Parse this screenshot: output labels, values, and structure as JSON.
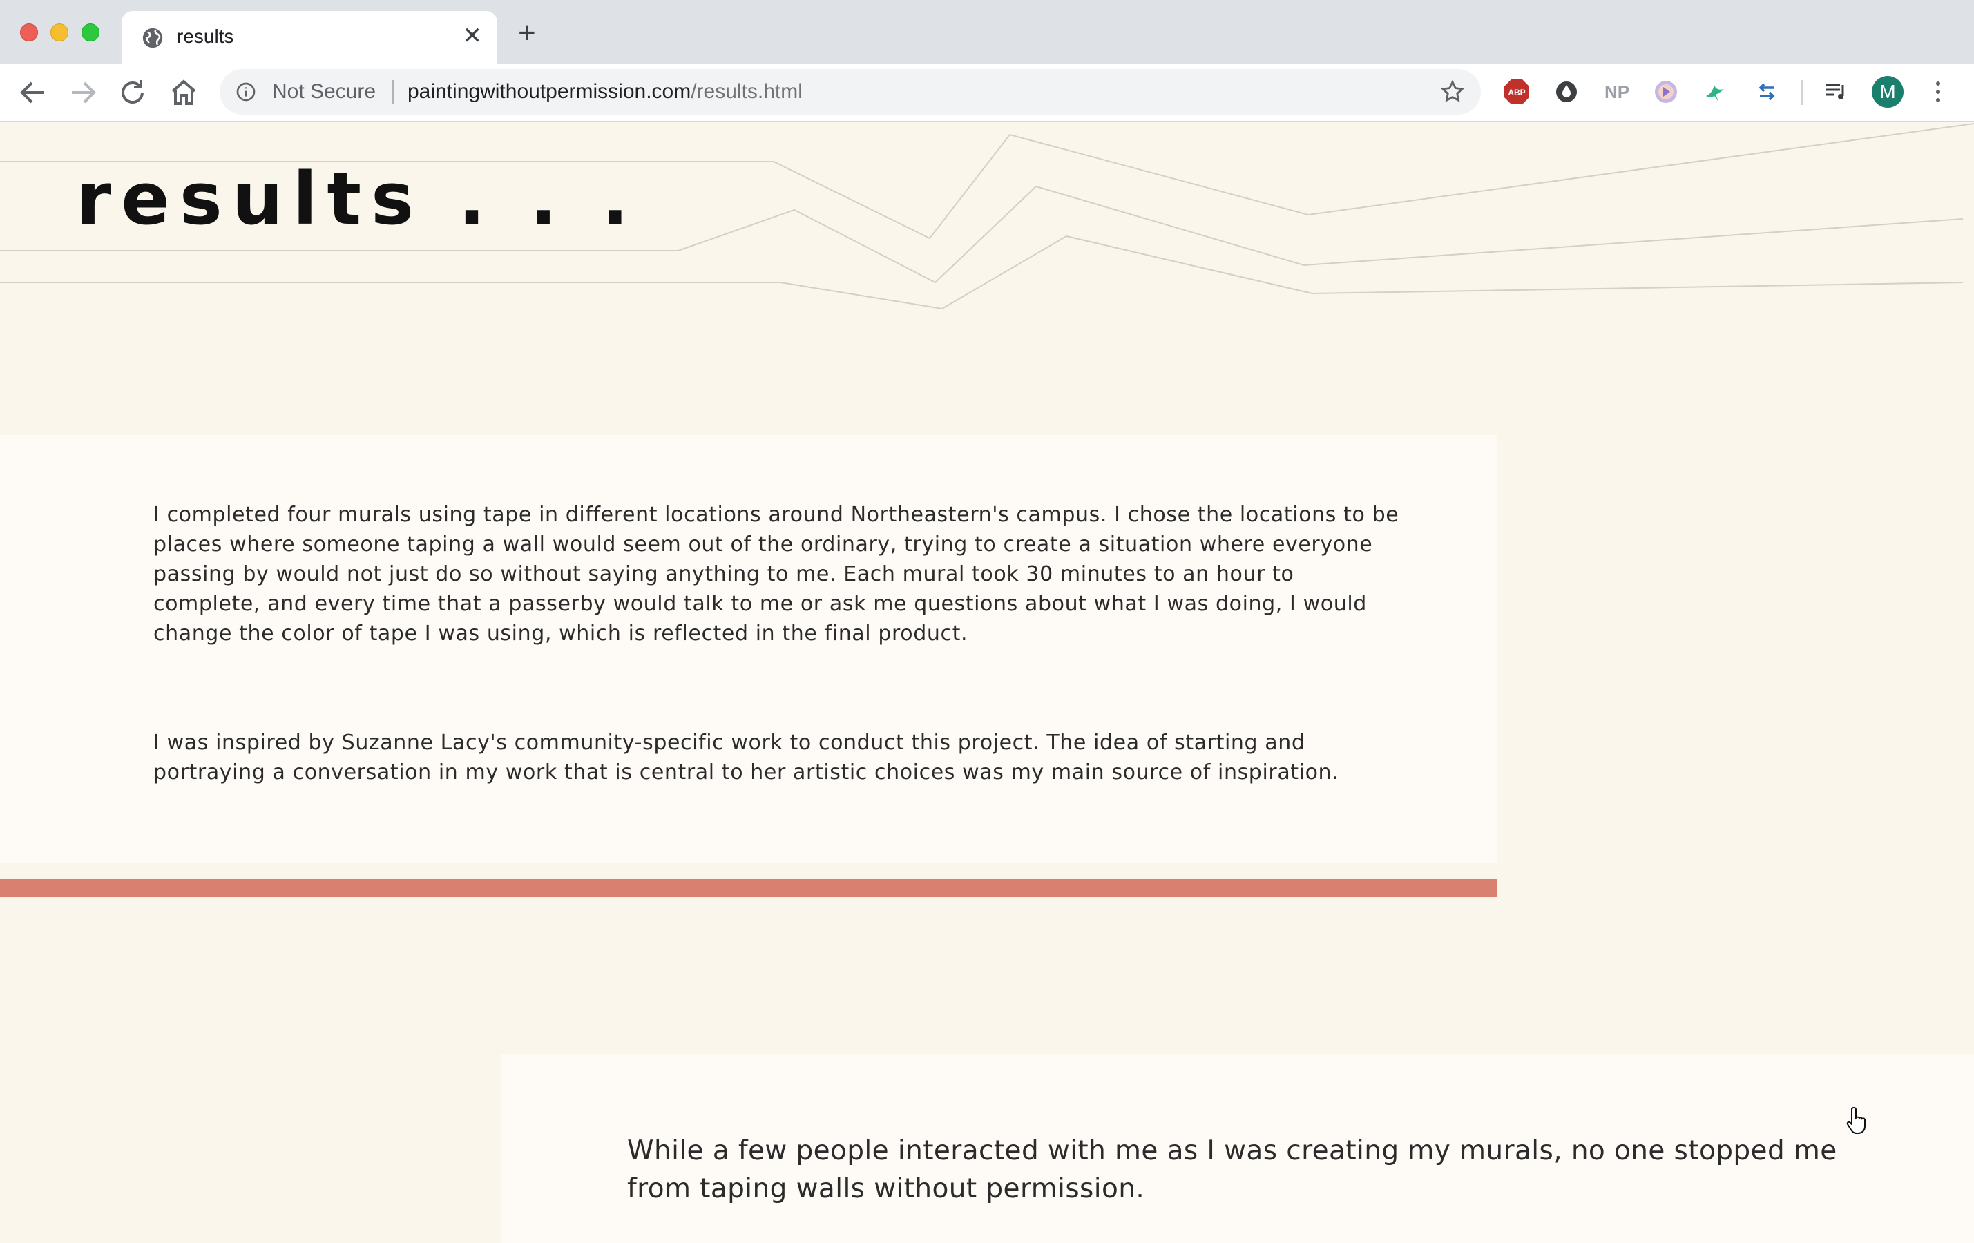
{
  "browser": {
    "tab_title": "results",
    "new_tab_symbol": "+",
    "close_symbol": "✕",
    "security_label": "Not Secure",
    "url_host": "paintingwithoutpermission.com",
    "url_path": "/results.html",
    "profile_initial": "M",
    "extension_labels": {
      "abp": "ABP",
      "np": "NP"
    },
    "icons": [
      "globe-icon",
      "back-icon",
      "forward-icon",
      "reload-icon",
      "home-icon",
      "info-icon",
      "star-icon",
      "adblock-icon",
      "drop-icon",
      "np-icon",
      "play-icon",
      "bird-icon",
      "arrows-icon",
      "media-icon",
      "menu-icon"
    ]
  },
  "page": {
    "title": "results . . .",
    "paragraph_1": "I completed four murals using tape in different locations around Northeastern's campus. I chose the locations to be places where someone taping a wall would seem out of the ordinary, trying to create a situation where everyone passing by would not just do so without saying anything to me. Each mural took 30 minutes to an hour to complete, and every time that a passerby would talk to me or ask me questions about what I was doing, I would change the color of tape I was using, which is reflected in the final product.",
    "paragraph_2": "I was inspired by Suzanne Lacy's community-specific work to conduct this project. The idea of starting and portraying a conversation in my work that is central to her artistic choices was my main source of inspiration.",
    "quote": "While a few people interacted with me as I was creating my murals, no one stopped me from taping walls without permission."
  },
  "colors": {
    "page_background": "#fbf6ec",
    "card_background": "#fefbf6",
    "accent_bar": "#d98070",
    "text": "#2b2b2b"
  }
}
